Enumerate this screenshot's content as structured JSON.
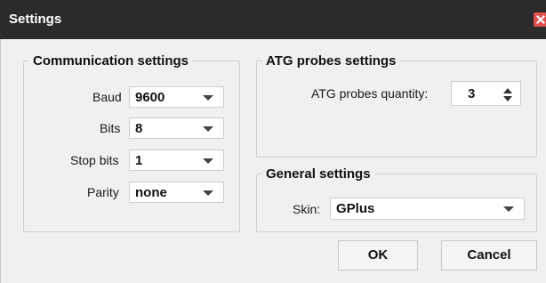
{
  "window": {
    "title": "Settings"
  },
  "communication": {
    "legend": "Communication settings",
    "baud_label": "Baud",
    "baud_value": "9600",
    "bits_label": "Bits",
    "bits_value": "8",
    "stopbits_label": "Stop bits",
    "stopbits_value": "1",
    "parity_label": "Parity",
    "parity_value": "none"
  },
  "atg": {
    "legend": "ATG probes settings",
    "quantity_label": "ATG probes quantity:",
    "quantity_value": "3"
  },
  "general": {
    "legend": "General settings",
    "skin_label": "Skin:",
    "skin_value": "GPlus"
  },
  "buttons": {
    "ok": "OK",
    "cancel": "Cancel"
  },
  "icons": [
    "close-icon",
    "dropdown-arrow-icon",
    "spin-up-icon",
    "spin-down-icon"
  ]
}
